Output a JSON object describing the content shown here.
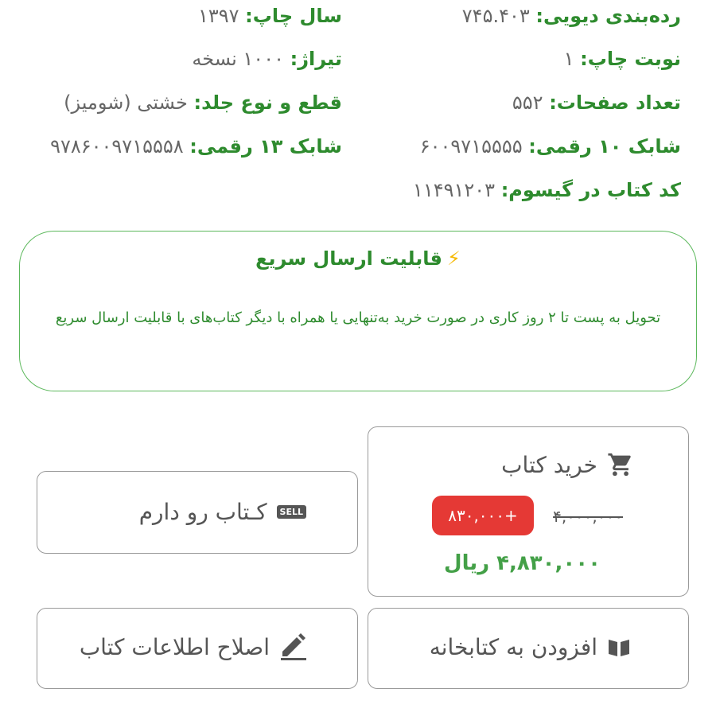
{
  "specs": {
    "dewey": {
      "label": "رده‌بندی دیویی:",
      "value": "۷۴۵.۴۰۳"
    },
    "print_year": {
      "label": "سال چاپ:",
      "value": "۱۳۹۷"
    },
    "print_run": {
      "label": "نوبت چاپ:",
      "value": "۱"
    },
    "circulation": {
      "label": "تیراژ:",
      "value": "۱۰۰۰ نسخه"
    },
    "pages": {
      "label": "تعداد صفحات:",
      "value": "۵۵۲"
    },
    "size_binding": {
      "label": "قطع و نوع جلد:",
      "value": "خشتی (شومیز)"
    },
    "isbn10": {
      "label": "شابک ۱۰ رقمی:",
      "value": "۶۰۰۹۷۱۵۵۵۵"
    },
    "isbn13": {
      "label": "شابک ۱۳ رقمی:",
      "value": "۹۷۸۶۰۰۹۷۱۵۵۵۸"
    },
    "gisoom_code": {
      "label": "کد کتاب در گیسوم:",
      "value": "۱۱۴۹۱۲۰۳"
    }
  },
  "fast_shipping": {
    "icon": "lightning-icon",
    "title": "قابلیت ارسال سریع",
    "description": "تحویل به پست تا ۲ روز کاری در صورت خرید به‌تنهایی یا همراه با دیگر کتاب‌های با قابلیت ارسال سریع"
  },
  "buy": {
    "icon": "cart-icon",
    "label": "خرید کتاب",
    "old_price": "۴,۰۰۰,۰۰۰",
    "discount": "+۸۳۰,۰۰۰",
    "final_price": "۴,۸۳۰,۰۰۰ ریال"
  },
  "have_book": {
    "icon": "sell-icon",
    "badge": "SELL",
    "label": "کـتاب رو دارم"
  },
  "add_library": {
    "icon": "book-open-icon",
    "label": "افزودن به کتابخانه"
  },
  "edit_info": {
    "icon": "pencil-icon",
    "label": "اصلاح اطلاعات کتاب"
  },
  "colors": {
    "label_green": "#2e8b2e",
    "price_green": "#43a047",
    "discount_red": "#e53935",
    "border_gray": "#9a9a9a"
  }
}
